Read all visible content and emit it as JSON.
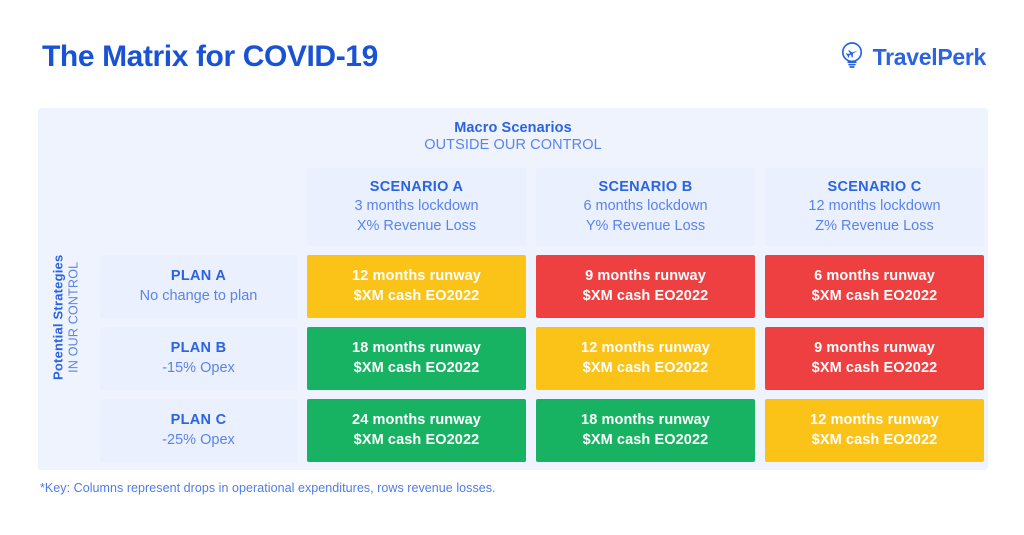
{
  "header": {
    "title": "The Matrix for COVID-19",
    "brand_name": "TravelPerk",
    "brand_icon": "lightbulb-airplane-icon",
    "title_color": "#1a52d6",
    "brand_color": "#2b63e0"
  },
  "matrix": {
    "macro": {
      "title": "Macro Scenarios",
      "subtitle": "OUTSIDE OUR CONTROL"
    },
    "rail": {
      "title": "Potential Strategies",
      "subtitle": "IN OUR CONTROL"
    },
    "column_headers": [
      {
        "name": "SCENARIO A",
        "line2": "3 months lockdown",
        "line3": "X% Revenue Loss"
      },
      {
        "name": "SCENARIO B",
        "line2": "6 months lockdown",
        "line3": "Y% Revenue Loss"
      },
      {
        "name": "SCENARIO C",
        "line2": "12 months lockdown",
        "line3": "Z% Revenue Loss"
      }
    ],
    "row_headers": [
      {
        "name": "PLAN A",
        "line2": "No change to plan"
      },
      {
        "name": "PLAN B",
        "line2": "-15% Opex"
      },
      {
        "name": "PLAN C",
        "line2": "-25% Opex"
      }
    ],
    "cells": [
      [
        {
          "line1": "12 months runway",
          "line2": "$XM cash EO2022",
          "status": "yellow"
        },
        {
          "line1": "9 months runway",
          "line2": "$XM cash EO2022",
          "status": "red"
        },
        {
          "line1": "6 months runway",
          "line2": "$XM cash EO2022",
          "status": "red"
        }
      ],
      [
        {
          "line1": "18 months runway",
          "line2": "$XM cash EO2022",
          "status": "green"
        },
        {
          "line1": "12 months runway",
          "line2": "$XM cash EO2022",
          "status": "yellow"
        },
        {
          "line1": "9 months runway",
          "line2": "$XM cash EO2022",
          "status": "red"
        }
      ],
      [
        {
          "line1": "24 months runway",
          "line2": "$XM cash EO2022",
          "status": "green"
        },
        {
          "line1": "18 months runway",
          "line2": "$XM cash EO2022",
          "status": "green"
        },
        {
          "line1": "12 months runway",
          "line2": "$XM cash EO2022",
          "status": "yellow"
        }
      ]
    ],
    "status_colors": {
      "green": "#17b363",
      "yellow": "#fbc318",
      "red": "#ee4040"
    },
    "panel_color": "#eef3fd"
  },
  "footnote": "*Key: Columns represent drops in operational expenditures, rows revenue losses."
}
